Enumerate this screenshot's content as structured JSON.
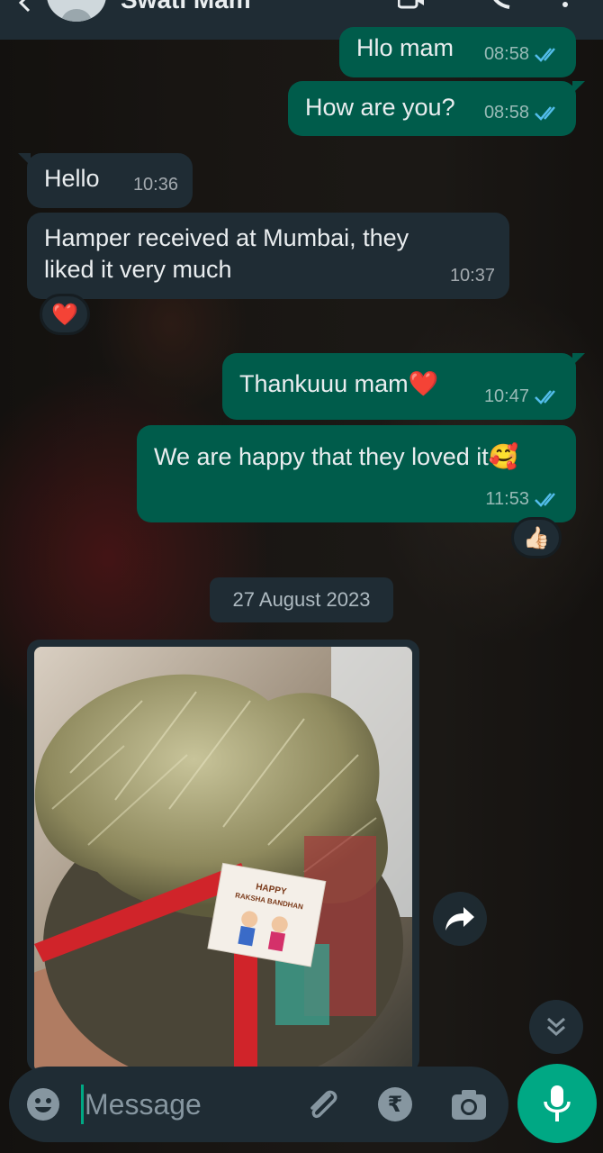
{
  "header": {
    "contact_name": "Swati Mam"
  },
  "messages": [
    {
      "direction": "out",
      "text": "Hlo mam",
      "time": "08:58",
      "status": "read"
    },
    {
      "direction": "out",
      "text": "How are you?",
      "time": "08:58",
      "status": "read"
    },
    {
      "direction": "in",
      "text": "Hello",
      "time": "10:36"
    },
    {
      "direction": "in",
      "text_line1": "Hamper received at Mumbai, they",
      "text_line2": "liked it very much",
      "time": "10:37",
      "reaction": "❤️"
    },
    {
      "direction": "out",
      "text": "Thankuuu mam❤️",
      "time": "10:47",
      "status": "read"
    },
    {
      "direction": "out",
      "text": "We are happy that they loved it🥰",
      "time": "11:53",
      "status": "read",
      "reaction": "👍🏻"
    }
  ],
  "date_separator": "27 August 2023",
  "image_message": {
    "tag_line1": "HAPPY",
    "tag_line2": "RAKSHA BANDHAN"
  },
  "composer": {
    "placeholder": "Message"
  },
  "colors": {
    "outgoing_bubble": "#005c4b",
    "incoming_bubble": "#1f2c34",
    "accent": "#00a884",
    "read_ticks": "#53bdeb"
  },
  "icons": [
    "back-arrow-icon",
    "avatar",
    "video-call-icon",
    "phone-icon",
    "more-icon",
    "emoji-icon",
    "attach-icon",
    "rupee-icon",
    "camera-icon",
    "mic-icon",
    "forward-icon",
    "scroll-down-icon"
  ]
}
